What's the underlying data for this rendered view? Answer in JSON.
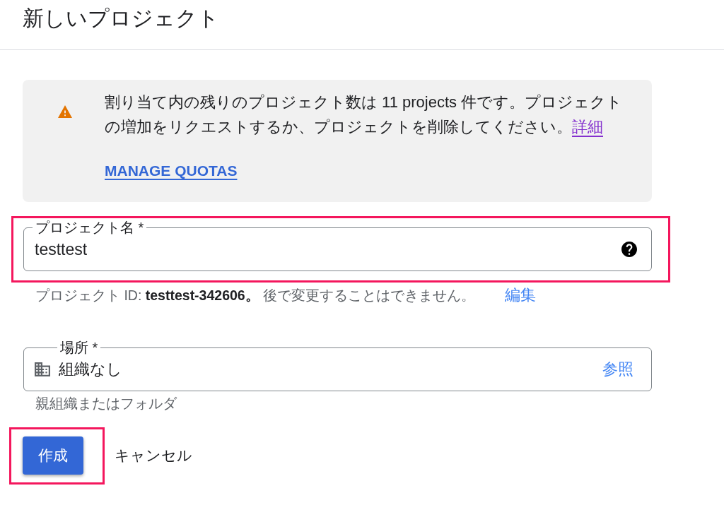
{
  "header": {
    "title": "新しいプロジェクト"
  },
  "quota_notice": {
    "message": "割り当て内の残りのプロジェクト数は 11 projects 件です。プロジェクトの増加をリクエストするか、プロジェクトを削除してください。",
    "link": "詳細",
    "action": "MANAGE QUOTAS"
  },
  "fields": [
    {
      "kind": "text",
      "label": "プロジェクト名 *",
      "value": "testtest",
      "highlighted": true,
      "hint": "プロジェクト ID: **testtest-342606。** 後で変更することはできません。",
      "hint_link": "編集"
    },
    {
      "kind": "picker",
      "label": "場所 *",
      "value": "組織なし",
      "action": "参照",
      "highlighted": false,
      "hint": "親組織またはフォルダ"
    }
  ],
  "buttons": [
    {
      "kind": "primary",
      "label": "作成",
      "highlighted": true
    },
    {
      "kind": "text",
      "label": "キャンセル",
      "highlighted": false
    }
  ]
}
